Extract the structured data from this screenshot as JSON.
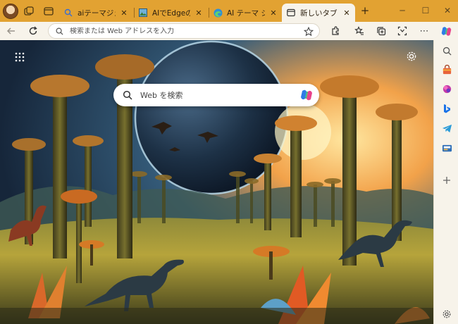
{
  "tabs": [
    {
      "title": "aiテーマジェネレータ",
      "favicon": "search-icon",
      "active": false
    },
    {
      "title": "AIでEdgeの見た目",
      "favicon": "image-icon",
      "active": false
    },
    {
      "title": "AI テーマ ジェネレーター",
      "favicon": "edge-icon",
      "active": false
    },
    {
      "title": "新しいタブ",
      "favicon": "newtab-icon",
      "active": true
    }
  ],
  "titlebar": {
    "new_tab_symbol": "+",
    "minimize_symbol": "─",
    "maximize_symbol": "☐",
    "close_symbol": "✕"
  },
  "toolbar": {
    "address_placeholder": "検索または Web アドレスを入力"
  },
  "newtab": {
    "search_placeholder": "Web を検索",
    "background": "AI-generated fantasy landscape with dinosaurs, giant trees and a large planet",
    "accent": "#e2a232"
  },
  "sidebar": {
    "items": [
      "search-icon",
      "shopping-icon",
      "copilot-apps-icon",
      "bing-icon",
      "telegram-icon",
      "outlook-icon",
      "add-icon",
      "settings-icon"
    ]
  },
  "colors": {
    "frame": "#e2a232",
    "toolbar_bg": "#f7f3ea",
    "active_tab": "#f7f3ea"
  }
}
